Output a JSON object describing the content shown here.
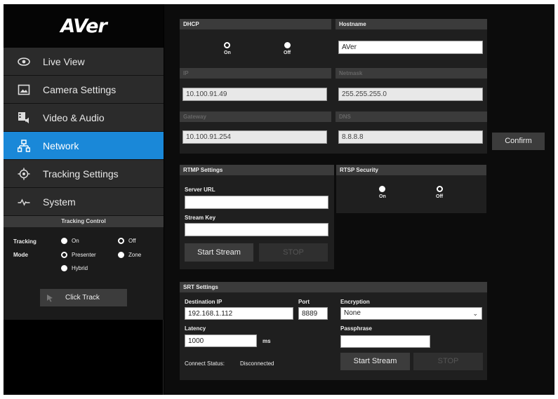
{
  "brand": {
    "logo": "AVer"
  },
  "sidebar": {
    "items": [
      {
        "label": "Live View",
        "icon": "eye-icon",
        "active": false
      },
      {
        "label": "Camera Settings",
        "icon": "image-icon",
        "active": false
      },
      {
        "label": "Video & Audio",
        "icon": "video-audio-icon",
        "active": false
      },
      {
        "label": "Network",
        "icon": "network-icon",
        "active": true
      },
      {
        "label": "Tracking Settings",
        "icon": "target-icon",
        "active": false
      },
      {
        "label": "System",
        "icon": "pulse-icon",
        "active": false
      }
    ],
    "tracking_control": {
      "title": "Tracking Control",
      "tracking_label": "Tracking",
      "mode_label": "Mode",
      "tracking_on": "On",
      "tracking_off": "Off",
      "mode_presenter": "Presenter",
      "mode_zone": "Zone",
      "mode_hybrid": "Hybrid",
      "tracking_selected": "On",
      "mode_selected": "Zone",
      "click_track_label": "Click Track"
    }
  },
  "network": {
    "dhcp": {
      "title": "DHCP",
      "on_label": "On",
      "off_label": "Off",
      "selected": "Off"
    },
    "hostname": {
      "title": "Hostname",
      "value": "AVer"
    },
    "ip": {
      "title": "IP",
      "value": "10.100.91.49"
    },
    "netmask": {
      "title": "Netmask",
      "value": "255.255.255.0"
    },
    "gateway": {
      "title": "Gateway",
      "value": "10.100.91.254"
    },
    "dns": {
      "title": "DNS",
      "value": "8.8.8.8"
    },
    "confirm_label": "Confirm"
  },
  "rtmp": {
    "title": "RTMP Settings",
    "server_url_label": "Server URL",
    "server_url_value": "",
    "stream_key_label": "Stream Key",
    "stream_key_value": "",
    "start_label": "Start Stream",
    "stop_label": "STOP"
  },
  "rtsp": {
    "title": "RTSP Security",
    "on_label": "On",
    "off_label": "Off",
    "selected": "On"
  },
  "srt": {
    "title": "SRT Settings",
    "dest_ip_label": "Destination IP",
    "dest_ip_value": "192.168.1.112",
    "port_label": "Port",
    "port_value": "8889",
    "encryption_label": "Encryption",
    "encryption_value": "None",
    "latency_label": "Latency",
    "latency_value": "1000",
    "latency_unit": "ms",
    "passphrase_label": "Passphrase",
    "passphrase_value": "",
    "connect_status_label": "Connect Status:",
    "connect_status_value": "Disconnected",
    "start_label": "Start Stream",
    "stop_label": "STOP"
  },
  "colors": {
    "accent": "#1a88d8",
    "panel": "#1f1f1f",
    "header": "#3b3b3b"
  }
}
